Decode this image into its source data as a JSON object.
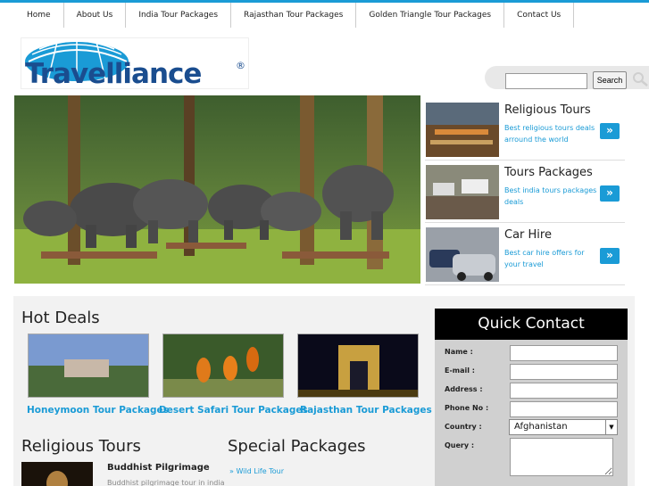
{
  "nav": {
    "items": [
      "Home",
      "About Us",
      "India Tour Packages",
      "Rajasthan Tour Packages",
      "Golden Triangle Tour Packages",
      "Contact Us"
    ]
  },
  "logo": {
    "text": "Travelliance",
    "reg": "®"
  },
  "search": {
    "button": "Search",
    "placeholder": ""
  },
  "promos": [
    {
      "title": "Religious Tours",
      "desc": "Best religious tours deals arround the world",
      "arrow": "»"
    },
    {
      "title": "Tours Packages",
      "desc": "Best india tours packages deals",
      "arrow": "»"
    },
    {
      "title": "Car Hire",
      "desc": "Best car hire offers for your travel",
      "arrow": "»"
    }
  ],
  "hot_deals": {
    "title": "Hot Deals",
    "items": [
      "Honeymoon Tour Packages",
      "Desert Safari Tour Packages",
      "Rajasthan Tour Packages"
    ]
  },
  "religious_tours": {
    "title": "Religious Tours",
    "item_title": "Buddhist Pilgrimage",
    "item_desc": "Buddhist pilgrimage tour in india"
  },
  "special_packages": {
    "title": "Special Packages",
    "link": "» Wild Life Tour"
  },
  "quick_contact": {
    "title": "Quick Contact",
    "labels": {
      "name": "Name :",
      "email": "E-mail :",
      "address": "Address :",
      "phone": "Phone No :",
      "country": "Country :",
      "query": "Query :"
    },
    "country_value": "Afghanistan"
  },
  "colors": {
    "accent": "#1a9bd6",
    "logo": "#1a4d8f"
  }
}
